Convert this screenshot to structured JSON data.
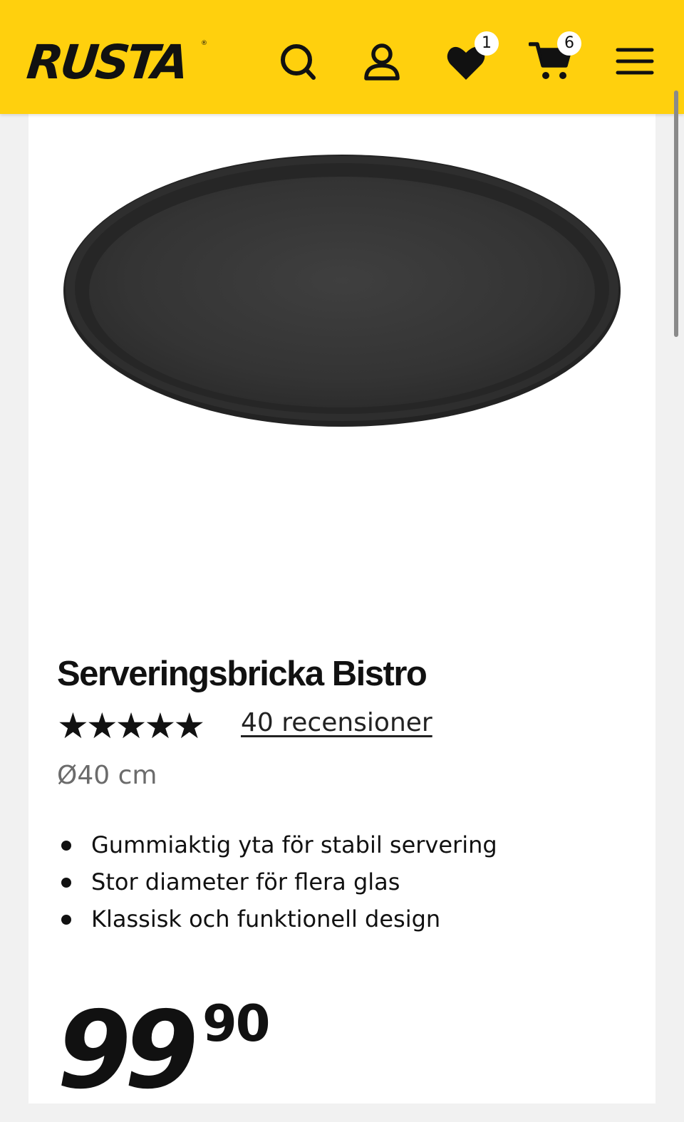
{
  "header": {
    "logo": "RUSTA",
    "logo_mark": "®",
    "icons": [
      "search-icon",
      "user-icon",
      "heart-icon",
      "cart-icon",
      "menu-icon"
    ],
    "wishlist_count": "1",
    "cart_count": "6",
    "brand_color": "#ffd00d"
  },
  "product": {
    "title": "Serveringsbricka Bistro",
    "rating_stars": 5,
    "reviews_label": "40 recensioner",
    "dimension": "Ø40 cm",
    "features": [
      "Gummiaktig yta för stabil servering",
      "Stor diameter för flera glas",
      "Klassisk och funktionell design"
    ],
    "price_integer": "99",
    "price_decimals": "90"
  }
}
